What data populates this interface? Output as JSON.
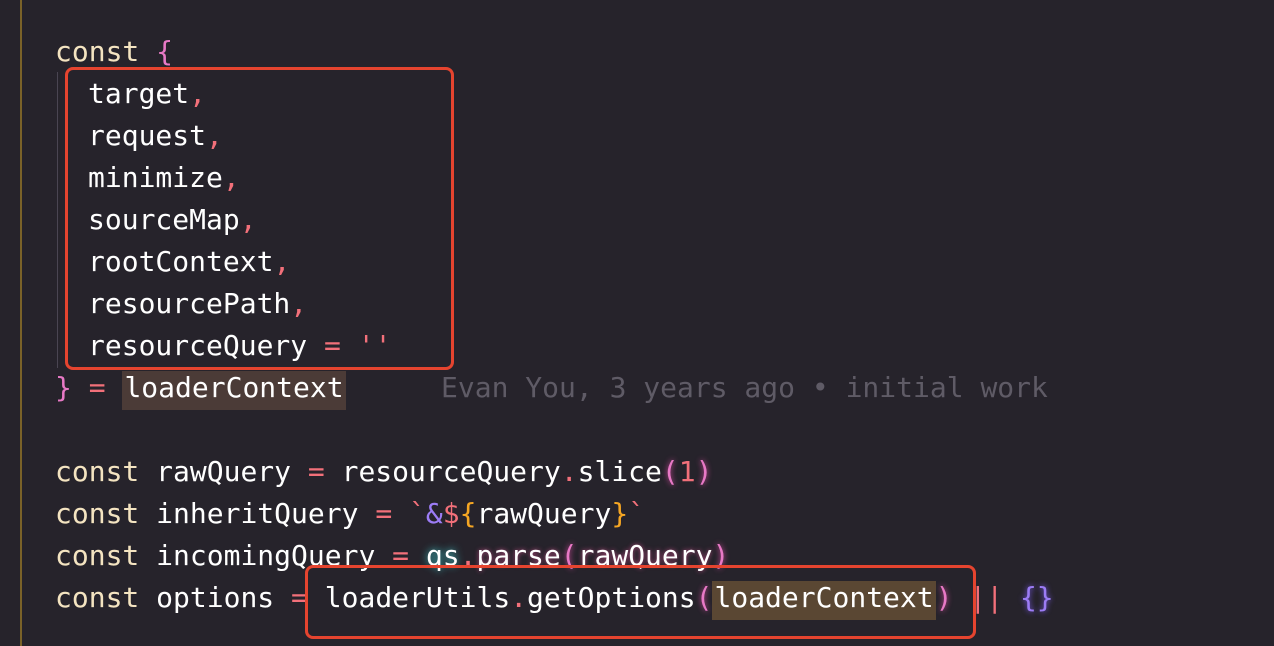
{
  "code": {
    "line1": {
      "kw": "const",
      "brace": "{"
    },
    "destructured": [
      {
        "name": "target",
        "comma": ","
      },
      {
        "name": "request",
        "comma": ","
      },
      {
        "name": "minimize",
        "comma": ","
      },
      {
        "name": "sourceMap",
        "comma": ","
      },
      {
        "name": "rootContext",
        "comma": ","
      },
      {
        "name": "resourcePath",
        "comma": ","
      },
      {
        "name": "resourceQuery",
        "op": "=",
        "default": "''"
      }
    ],
    "close_line": {
      "brace": "}",
      "op": "=",
      "value": "loaderContext"
    },
    "blame": "Evan You, 3 years ago • initial work",
    "rawQuery_line": {
      "kw": "const",
      "name": "rawQuery",
      "op": "=",
      "obj": "resourceQuery",
      "dot": ".",
      "method": "slice",
      "open": "(",
      "arg": "1",
      "close": ")"
    },
    "inheritQuery_line": {
      "kw": "const",
      "name": "inheritQuery",
      "op": "=",
      "tick_open": "`",
      "amp": "&",
      "dollar": "$",
      "brace_open": "{",
      "inner": "rawQuery",
      "brace_close": "}",
      "tick_close": "`"
    },
    "incomingQuery_line": {
      "kw": "const",
      "name": "incomingQuery",
      "op": "=",
      "obj": "qs",
      "dot": ".",
      "method": "parse",
      "open": "(",
      "arg": "rawQuery",
      "close": ")"
    },
    "options_line": {
      "kw": "const",
      "name": "options",
      "op": "=",
      "obj": "loaderUtils",
      "dot": ".",
      "method": "getOptions",
      "open": "(",
      "arg": "loaderContext",
      "close": ")",
      "or": "||",
      "empty": "{}"
    }
  },
  "colors": {
    "background": "#26232b",
    "annotation_box": "#e5442f"
  }
}
